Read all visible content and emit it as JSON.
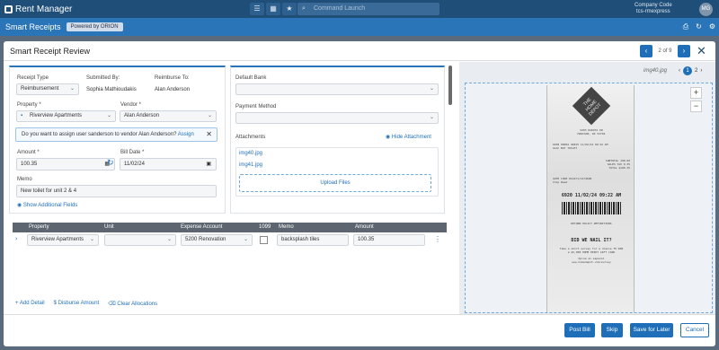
{
  "app": {
    "logo_text": "Rent Manager",
    "command_placeholder": "Command Launch",
    "company_code_label": "Company Code",
    "company_code": "tcs-rmexpress",
    "avatar_initials": "MG",
    "page_title": "Smart Receipts",
    "powered_by": "Powered by ORION"
  },
  "modal": {
    "title": "Smart Receipt Review",
    "pager": "2 of 9"
  },
  "form": {
    "receipt_type_label": "Receipt Type",
    "receipt_type_value": "Reimbursement",
    "submitted_by_label": "Submitted By:",
    "submitted_by_value": "Sophia Mathioudakis",
    "reimburse_to_label": "Reimburse To:",
    "reimburse_to_value": "Alan Anderson",
    "property_label": "Property *",
    "property_value": "Riverview Apartments",
    "vendor_label": "Vendor *",
    "vendor_value": "Alan Anderson",
    "notice_text": "Do you want to assign user sanderson to vendor Alan Anderson?",
    "notice_link": "Assign",
    "amount_label": "Amount *",
    "amount_value": "100.35",
    "bill_date_label": "Bill Date *",
    "bill_date_value": "11/02/24",
    "memo_label": "Memo",
    "memo_value": "New toilet for unit 2 & 4",
    "show_fields": "Show Additional Fields"
  },
  "bank": {
    "default_bank_label": "Default Bank",
    "payment_method_label": "Payment Method",
    "attachments_label": "Attachments",
    "hide_attachment": "Hide Attachment",
    "files": [
      "img40.jpg",
      "img41.jpg"
    ],
    "upload": "Upload Files"
  },
  "grid": {
    "headers": [
      "Property",
      "Unit",
      "Expense Account",
      "1099",
      "Memo",
      "Amount"
    ],
    "row": {
      "property": "Riverview Apartments",
      "unit": "",
      "expense_account": "5200 Renovation",
      "memo": "backsplash tiles",
      "amount": "100.35"
    },
    "add_detail": "Add Detail",
    "disburse_amount": "Disburse Amount",
    "clear_allocations": "Clear Allocations"
  },
  "viewer": {
    "image_name": "img40.jpg",
    "pages": [
      "1",
      "2"
    ],
    "receipt_lines": [
      "5203 DAKOTA DR",
      "MADISON, WI 53704",
      "6938 00002 46835   11/02/24 09:22 AM",
      "GLAC BAY TOILET",
      "SUBTOTAL 100.00",
      "SALES TAX 0.35",
      "TOTAL $100.35",
      "AUTH CODE 012471/1274690",
      "Chip Read",
      "6920  11/02/24  09:22 AM",
      "RETURN POLICY DEFINITIONS",
      "DID WE NAIL IT?",
      "Take a short survey for a chance TO WIN",
      "a $5,000 HOME DEPOT GIFT CARD",
      "Opine en espanol",
      "www.homedepot.com/survey"
    ]
  },
  "footer": {
    "post_bill": "Post Bill",
    "skip": "Skip",
    "save_later": "Save for Later",
    "cancel": "Cancel"
  }
}
